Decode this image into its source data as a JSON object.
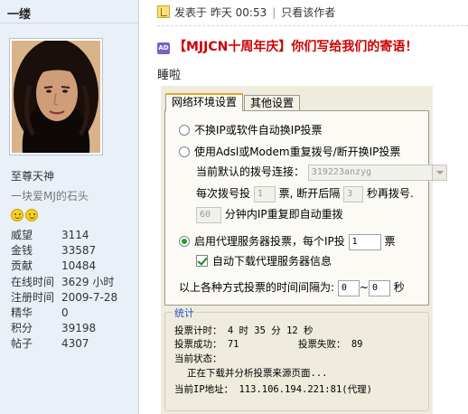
{
  "sidebar": {
    "username": "一缕",
    "user_title": "至尊天神",
    "signature": "一块爱MJ的石头",
    "medals": [
      "smiley-medal",
      "smiley-medal"
    ],
    "stats": [
      {
        "label": "威望",
        "value": "3114"
      },
      {
        "label": "金钱",
        "value": "33587"
      },
      {
        "label": "贡献",
        "value": "10484"
      },
      {
        "label": "在线时间",
        "value": "3629 小时"
      },
      {
        "label": "注册时间",
        "value": "2009-7-28"
      },
      {
        "label": "精华",
        "value": "0"
      },
      {
        "label": "积分",
        "value": "39198"
      },
      {
        "label": "帖子",
        "value": "4307"
      }
    ]
  },
  "post": {
    "posted_prefix": "发表于",
    "posted_time": "昨天 00:53",
    "author_only": "只看该作者",
    "badge": "AD",
    "title": "【MJJCN十周年庆】你们写给我们的寄语！",
    "text": "睡啦"
  },
  "app": {
    "tabs": [
      "网络环境设置",
      "其他设置"
    ],
    "options": {
      "no_ip_change": "不换IP或软件自动换IP投票",
      "adsl_modem": "使用Adsl或Modem重复拨号/断开换IP投票",
      "dial_label": "当前默认的拨号连接：",
      "dial_value": "319223anzyg",
      "every_prefix": "每次拨号投",
      "votes_value": "1",
      "votes_suffix": "票, 断开后隔",
      "wait_value": "3",
      "wait_suffix": "秒再拨号.",
      "retry_value": "60",
      "retry_suffix": "分钟内IP重复即自动重拨",
      "proxy": "启用代理服务器投票，每个IP投",
      "proxy_votes_value": "1",
      "proxy_unit": "票",
      "auto_download": "自动下载代理服务器信息",
      "interval_label": "以上各种方式投票的时间间隔为:",
      "interval_min": "0",
      "interval_sep": "~",
      "interval_max": "0",
      "interval_unit": "秒"
    },
    "stats": {
      "title": "统计",
      "timer_label": "投票计时：",
      "timer_value": "4 时 35 分 12 秒",
      "success_label": "投票成功：",
      "success_value": "71",
      "fail_label": "投票失败：",
      "fail_value": "89",
      "status_label": "当前状态：",
      "status_value": "正在下载并分析投票来源页面...",
      "ip_label": "当前IP地址：",
      "ip_value": "113.106.194.221:81(代理)"
    }
  },
  "colors": {
    "sidebar_bg": "#eaf0f8",
    "title_red": "#cc0000",
    "app_bg": "#efecdd",
    "tab_accent": "#e8a52b",
    "group_title_blue": "#2a4dc0"
  }
}
